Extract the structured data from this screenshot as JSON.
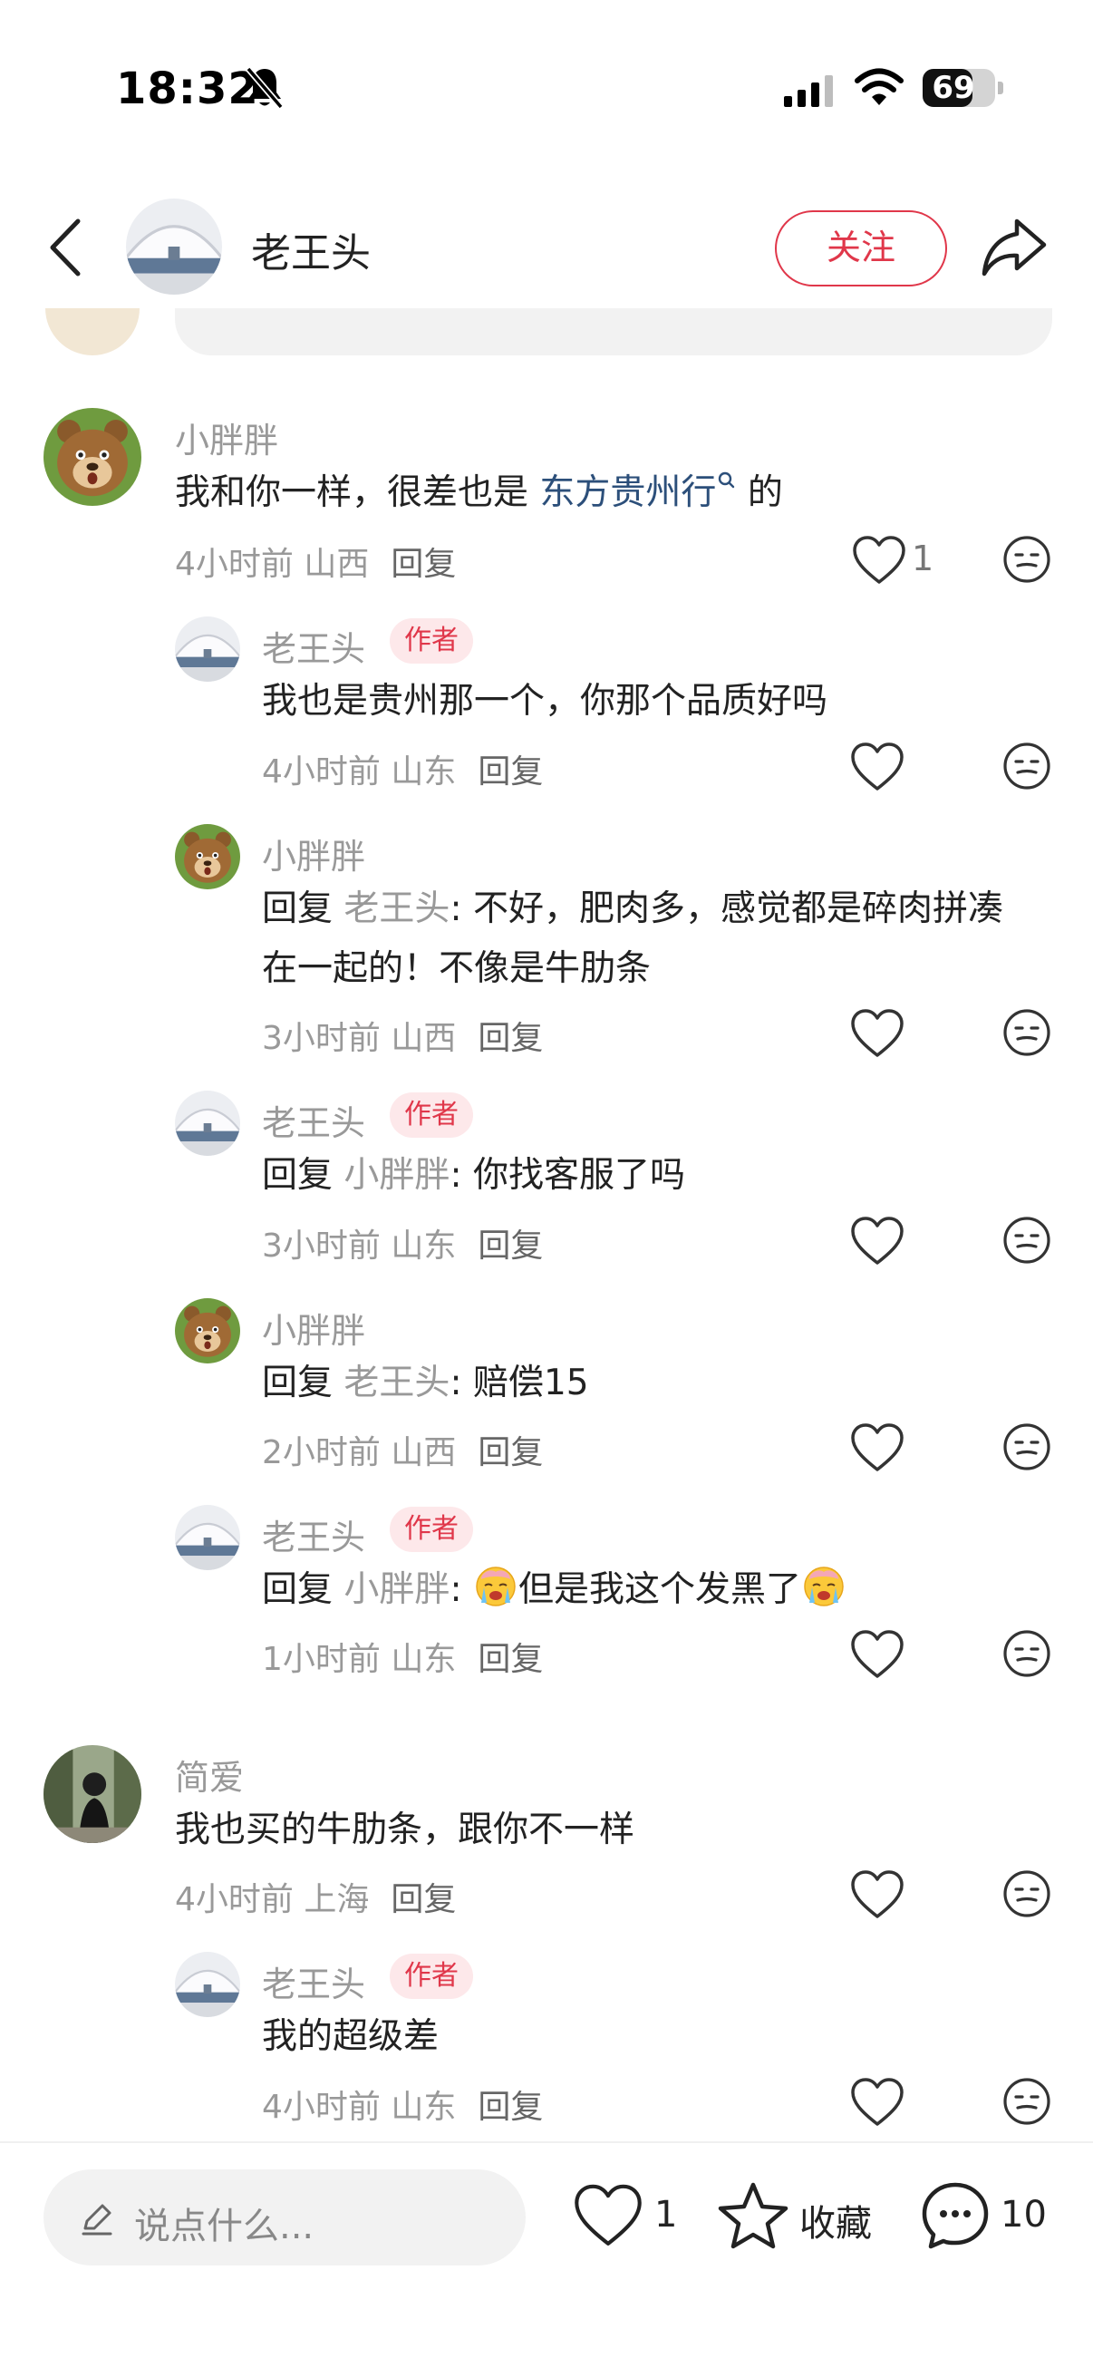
{
  "status_bar": {
    "time": "18:32",
    "battery": "69",
    "battery_level": 0.69
  },
  "header": {
    "title": "老王头",
    "follow_label": "关注"
  },
  "comments": [
    {
      "user": "小胖胖",
      "text_pre": "我和你一样，很差也是 ",
      "link": "东方贵州行",
      "text_post": " 的",
      "time": "4小时前 山西",
      "reply_label": "回复",
      "likes": "1",
      "replies": [
        {
          "user": "老王头",
          "badge": "作者",
          "text": "我也是贵州那一个，你那个品质好吗",
          "time": "4小时前 山东",
          "reply_label": "回复"
        },
        {
          "user": "小胖胖",
          "reply_prefix": "回复",
          "reply_to": "老王头",
          "text_line1": ": 不好，肥肉多，感觉都是碎肉拼凑",
          "text_line2": "在一起的！不像是牛肋条",
          "time": "3小时前 山西",
          "reply_label": "回复"
        },
        {
          "user": "老王头",
          "badge": "作者",
          "reply_prefix": "回复",
          "reply_to": "小胖胖",
          "text": ": 你找客服了吗",
          "time": "3小时前 山东",
          "reply_label": "回复"
        },
        {
          "user": "小胖胖",
          "reply_prefix": "回复",
          "reply_to": "老王头",
          "text": ": 赔偿15",
          "time": "2小时前 山西",
          "reply_label": "回复"
        },
        {
          "user": "老王头",
          "badge": "作者",
          "reply_prefix": "回复",
          "reply_to": "小胖胖",
          "text_pre": ": ",
          "text": "但是我这个发黑了",
          "time": "1小时前 山东",
          "reply_label": "回复"
        }
      ]
    },
    {
      "user": "简爱",
      "text": "我也买的牛肋条，跟你不一样",
      "time": "4小时前 上海",
      "reply_label": "回复",
      "replies": [
        {
          "user": "老王头",
          "badge": "作者",
          "text": "我的超级差",
          "time": "4小时前 山东",
          "reply_label": "回复"
        }
      ]
    }
  ],
  "bottom_bar": {
    "input_placeholder": "说点什么...",
    "like_count": "1",
    "collect_label": "收藏",
    "comment_count": "10"
  },
  "icons": [
    "bell-slash-icon",
    "signal-icon",
    "wifi-icon",
    "battery-icon",
    "back-icon",
    "share-icon",
    "heart-icon",
    "emoji-icon",
    "pencil-icon",
    "star-icon",
    "comment-icon",
    "crying-emoji-icon",
    "search-link-icon"
  ],
  "colors": {
    "accent": "#e0374a",
    "link": "#2c4f7a",
    "badge_bg": "#fde8ea",
    "muted": "#999999"
  }
}
